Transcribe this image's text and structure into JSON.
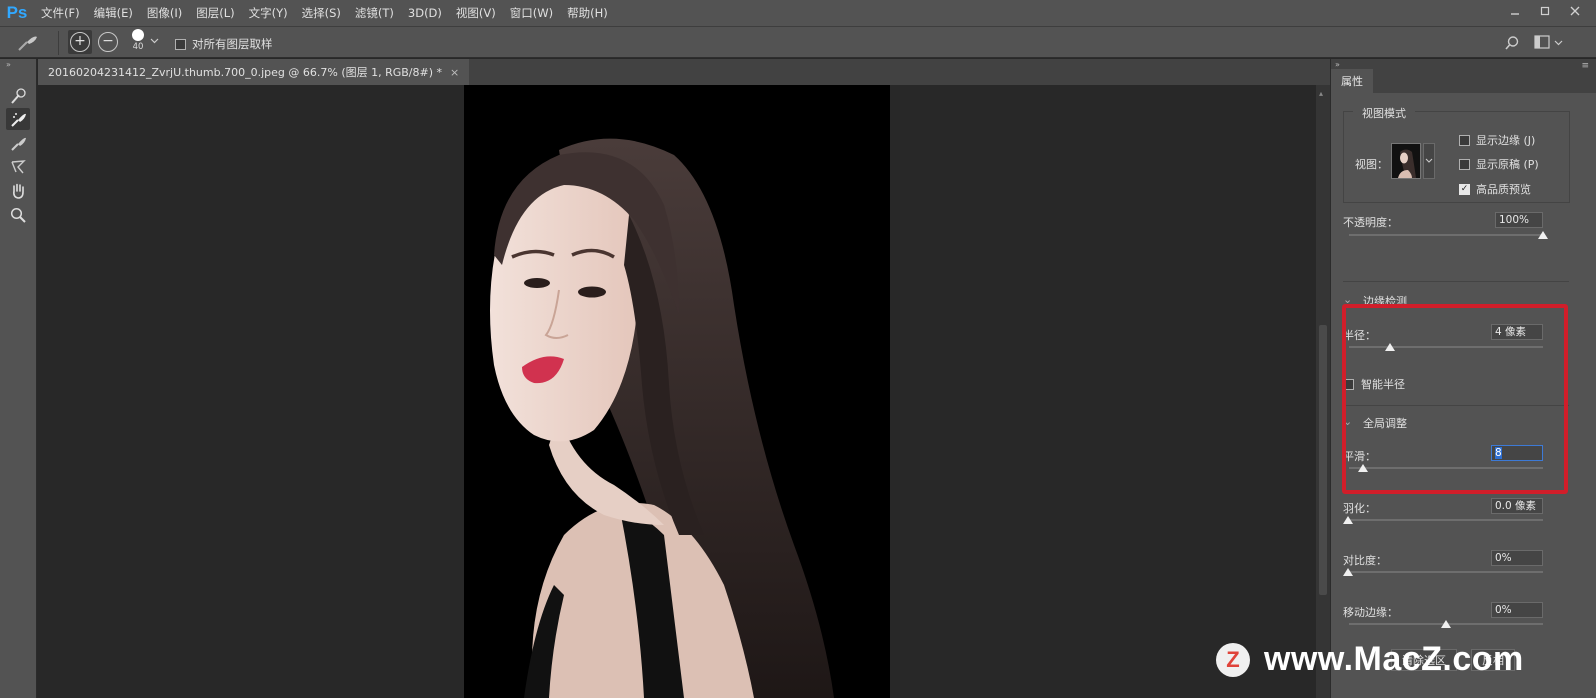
{
  "app": {
    "logo": "Ps",
    "brand_color": "#31a8ff",
    "menu": [
      "文件(F)",
      "编辑(E)",
      "图像(I)",
      "图层(L)",
      "文字(Y)",
      "选择(S)",
      "滤镜(T)",
      "3D(D)",
      "视图(V)",
      "窗口(W)",
      "帮助(H)"
    ],
    "window_controls": [
      "minimize-icon",
      "restore-icon",
      "close-icon"
    ]
  },
  "options_bar": {
    "brush_size": "40",
    "sample_all_layers_label": "对所有图层取样",
    "sample_all_layers_checked": false
  },
  "tools": [
    "quick-selection-brush-icon",
    "refine-edge-brush-icon",
    "brush-icon",
    "lasso-icon",
    "hand-icon",
    "zoom-icon"
  ],
  "document": {
    "tab_title": "20160204231412_ZvrjU.thumb.700_0.jpeg @ 66.7% (图层 1, RGB/8#) *",
    "close_glyph": "×"
  },
  "panel": {
    "tab_label": "属性",
    "view_mode": {
      "title": "视图模式",
      "view_label": "视图：",
      "show_edge_label": "显示边缘 (J)",
      "show_edge_checked": false,
      "show_original_label": "显示原稿 (P)",
      "show_original_checked": false,
      "high_quality_label": "高品质预览",
      "high_quality_checked": true
    },
    "opacity": {
      "label": "不透明度：",
      "value": "100%",
      "level": 1.0
    },
    "edge_detection": {
      "title": "边缘检测",
      "radius_label": "半径：",
      "radius_value": "4 像素",
      "radius_level": 0.2,
      "smart_radius_label": "智能半径",
      "smart_radius_checked": false
    },
    "global_refine": {
      "title": "全局调整",
      "smooth_label": "平滑：",
      "smooth_value": "8",
      "smooth_level": 0.08,
      "feather_label": "羽化：",
      "feather_value": "0.0 像素",
      "feather_level": 0.0,
      "contrast_label": "对比度：",
      "contrast_value": "0%",
      "contrast_level": 0.0,
      "shift_edge_label": "移动边缘：",
      "shift_edge_value": "0%",
      "shift_edge_level": 0.5
    },
    "bottom_buttons": [
      "清除选区",
      "反相"
    ],
    "highlight_color": "#d11e2a"
  },
  "watermark": {
    "text": "www.MacZ.com",
    "logo_letter": "Z",
    "logo_color": "#e0433a"
  }
}
